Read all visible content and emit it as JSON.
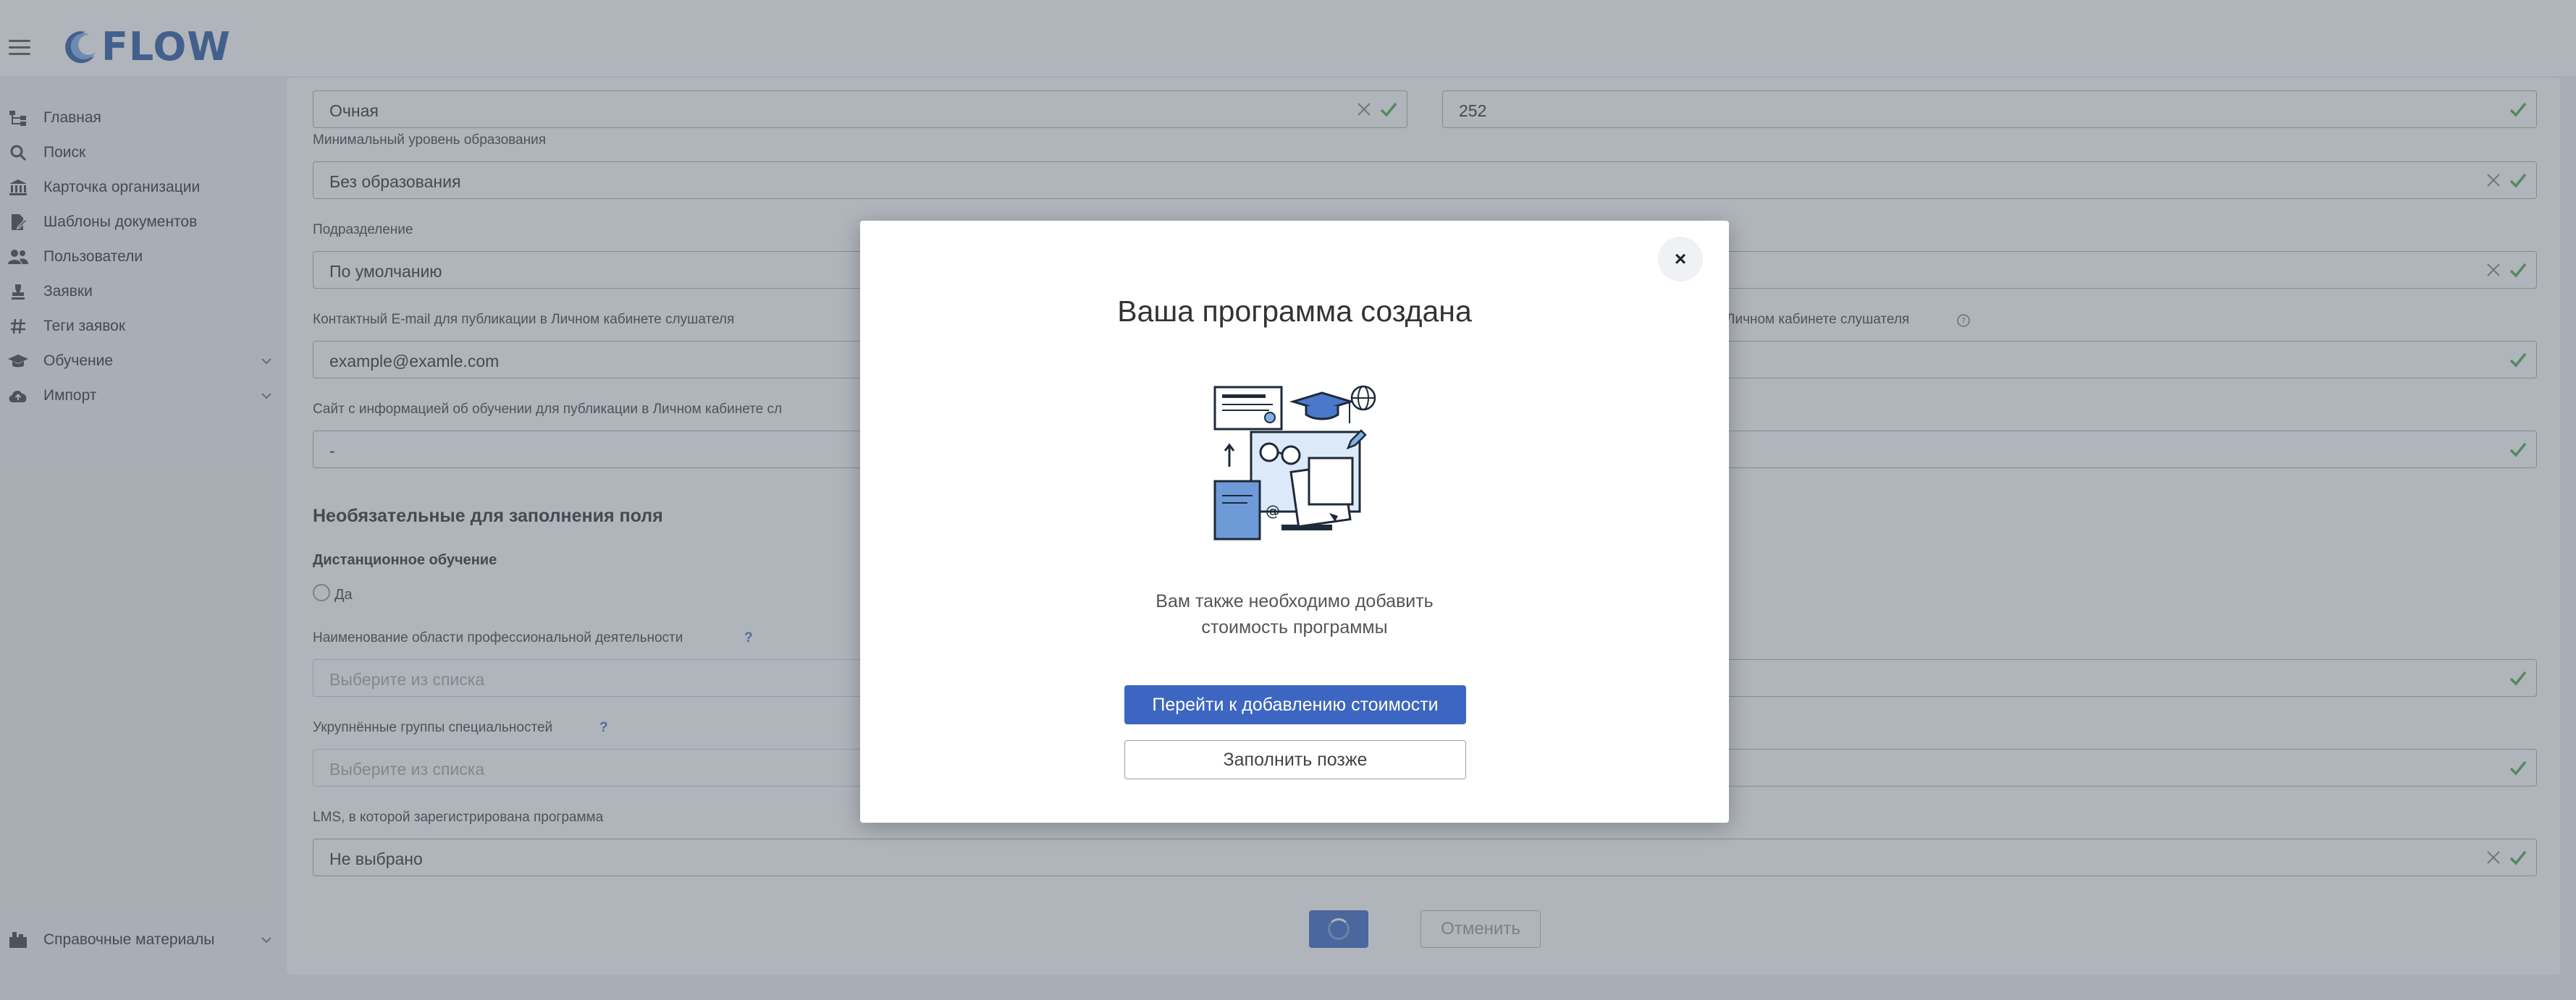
{
  "app": {
    "logo_text": "FLOW"
  },
  "sidebar": {
    "items": [
      {
        "label": "Главная",
        "icon": "sitemap-icon"
      },
      {
        "label": "Поиск",
        "icon": "search-icon"
      },
      {
        "label": "Карточка организации",
        "icon": "bank-icon"
      },
      {
        "label": "Шаблоны документов",
        "icon": "document-edit-icon"
      },
      {
        "label": "Пользователи",
        "icon": "users-icon"
      },
      {
        "label": "Заявки",
        "icon": "stamp-icon"
      },
      {
        "label": "Теги заявок",
        "icon": "hashtag-icon"
      },
      {
        "label": "Обучение",
        "icon": "graduation-cap-icon",
        "expandable": true
      },
      {
        "label": "Импорт",
        "icon": "cloud-upload-icon",
        "expandable": true
      }
    ],
    "footer_item": {
      "label": "Справочные материалы",
      "icon": "toolbox-icon",
      "expandable": true
    }
  },
  "form": {
    "study_form": {
      "value": "Очная"
    },
    "hours": {
      "value": "252"
    },
    "min_education": {
      "label": "Минимальный уровень образования",
      "value": "Без образования"
    },
    "department": {
      "label": "Подразделение",
      "value": "По умолчанию"
    },
    "contact_email": {
      "label": "Контактный E-mail для публикации в Личном кабинете слушателя",
      "value": "example@examle.com"
    },
    "right_label_partial": "Личном кабинете слушателя",
    "site": {
      "label": "Сайт с информацией об обучении для публикации в Личном кабинете сл",
      "value": "-"
    },
    "optional_section_title": "Необязательные для заполнения поля",
    "distance": {
      "label": "Дистанционное обучение",
      "option": "Да"
    },
    "prof_area": {
      "label": "Наименование области профессиональной деятельности",
      "hint": "?",
      "placeholder": "Выберите из списка"
    },
    "spec_groups": {
      "label": "Укрупнённые группы специальностей",
      "hint": "?",
      "placeholder": "Выберите из списка"
    },
    "lms": {
      "label": "LMS, в которой зарегистрирована программа",
      "value": "Не выбрано"
    },
    "cancel_label": "Отменить"
  },
  "modal": {
    "close_symbol": "×",
    "title": "Ваша программа создана",
    "text": "Вам также необходимо добавить стоимость программы",
    "primary_label": "Перейти к добавлению стоимости",
    "secondary_label": "Заполнить позже"
  },
  "colors": {
    "brand": "#2f5ea8",
    "primary_button": "#3c66c1",
    "valid_check": "#4caf50",
    "field_border_valid": "#8fca8a"
  }
}
